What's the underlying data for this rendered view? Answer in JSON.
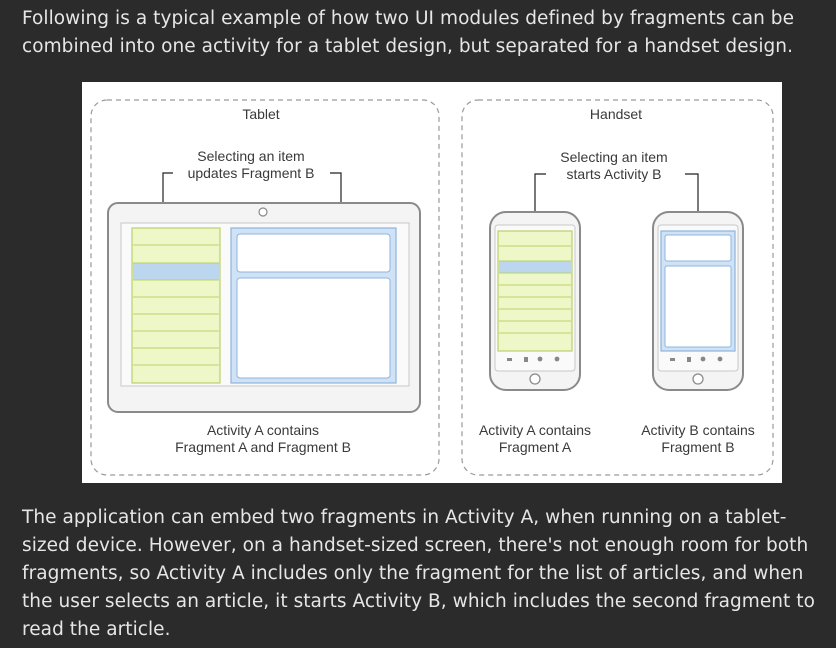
{
  "intro_text": "Following is a typical example of how two UI modules defined by fragments can be combined into one activity for a tablet design, but separated for a handset design.",
  "diagram": {
    "tablet": {
      "title": "Tablet",
      "callout_line1": "Selecting an item",
      "callout_line2": "updates Fragment B",
      "caption_line1": "Activity A contains",
      "caption_line2": "Fragment A and Fragment B"
    },
    "handset": {
      "title": "Handset",
      "callout_line1": "Selecting an item",
      "callout_line2": "starts Activity B",
      "phone_a_caption_line1": "Activity A contains",
      "phone_a_caption_line2": "Fragment A",
      "phone_b_caption_line1": "Activity B contains",
      "phone_b_caption_line2": "Fragment B"
    },
    "colors": {
      "list_fill": "#eef7c8",
      "list_border": "#b9d26a",
      "selected_fill": "#bcd6f0",
      "pane_fill": "#cfe2f6",
      "pane_border": "#8fb4dc",
      "device_border": "#8a8a8a"
    }
  },
  "outro_text": "The application can embed two fragments in Activity A, when running on a tablet-sized device. However, on a handset-sized screen, there's not enough room for both fragments, so Activity A includes only the fragment for the list of articles, and when the user selects an article, it starts Activity B, which includes the second fragment to read the article."
}
